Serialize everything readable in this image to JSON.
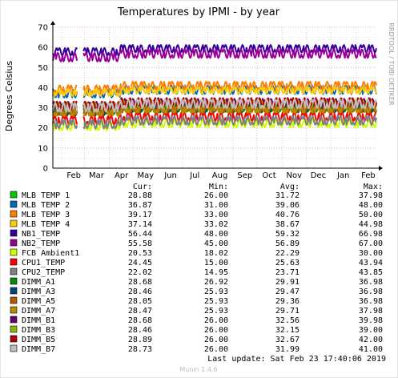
{
  "chart_data": {
    "type": "line",
    "title": "Temperatures by IPMI - by year",
    "ylabel": "Degrees Celsius",
    "ylim": [
      0,
      70
    ],
    "yticks": [
      0,
      10,
      20,
      30,
      40,
      50,
      60,
      70
    ],
    "x_tick_labels": [
      "Feb",
      "Mar",
      "Apr",
      "May",
      "Jun",
      "Jul",
      "Aug",
      "Sep",
      "Oct",
      "Nov",
      "Dec",
      "Jan",
      "Feb"
    ],
    "x_range": [
      "2018-01-21",
      "2019-02-26"
    ],
    "grid": true,
    "side_label": "RRDTOOL / TOBI OETIKER",
    "columns": [
      "Cur:",
      "Min:",
      "Avg:",
      "Max:"
    ],
    "series": [
      {
        "name": "MLB TEMP 1",
        "color": "#00cc00",
        "cur": "28.88",
        "min": "26.00",
        "avg": "31.72",
        "max": "37.98",
        "base": 31.7
      },
      {
        "name": "MLB TEMP 2",
        "color": "#0066b3",
        "cur": "36.87",
        "min": "31.00",
        "avg": "39.06",
        "max": "48.00",
        "base": 39
      },
      {
        "name": "MLB TEMP 3",
        "color": "#ff8000",
        "cur": "39.17",
        "min": "33.00",
        "avg": "40.76",
        "max": "50.00",
        "base": 40.8
      },
      {
        "name": "MLB TEMP 4",
        "color": "#ffcc00",
        "cur": "37.14",
        "min": "33.02",
        "avg": "38.67",
        "max": "44.98",
        "base": 38.7
      },
      {
        "name": "NB1_TEMP",
        "color": "#330099",
        "cur": "56.44",
        "min": "48.00",
        "avg": "59.32",
        "max": "66.98",
        "base": 59.3
      },
      {
        "name": "NB2_TEMP",
        "color": "#990099",
        "cur": "55.58",
        "min": "45.00",
        "avg": "56.89",
        "max": "67.00",
        "base": 56.9
      },
      {
        "name": "FCB Ambient1",
        "color": "#ccff00",
        "cur": "20.53",
        "min": "18.02",
        "avg": "22.29",
        "max": "30.00",
        "base": 22.3
      },
      {
        "name": "CPU1_TEMP",
        "color": "#ff0000",
        "cur": "24.45",
        "min": "15.00",
        "avg": "25.63",
        "max": "43.94",
        "base": 25.6
      },
      {
        "name": "CPU2_TEMP",
        "color": "#808080",
        "cur": "22.02",
        "min": "14.95",
        "avg": "23.71",
        "max": "43.85",
        "base": 23.7
      },
      {
        "name": "DIMM_A1",
        "color": "#008f00",
        "cur": "28.68",
        "min": "26.92",
        "avg": "29.91",
        "max": "36.98",
        "base": 29.9
      },
      {
        "name": "DIMM_A3",
        "color": "#00487d",
        "cur": "28.46",
        "min": "25.93",
        "avg": "29.47",
        "max": "36.98",
        "base": 29.5
      },
      {
        "name": "DIMM_A5",
        "color": "#b35a00",
        "cur": "28.05",
        "min": "25.93",
        "avg": "29.36",
        "max": "36.98",
        "base": 29.4
      },
      {
        "name": "DIMM_A7",
        "color": "#b38f00",
        "cur": "28.47",
        "min": "25.93",
        "avg": "29.71",
        "max": "37.98",
        "base": 29.7
      },
      {
        "name": "DIMM_B1",
        "color": "#6b006b",
        "cur": "28.68",
        "min": "26.00",
        "avg": "32.56",
        "max": "39.98",
        "base": 32.6
      },
      {
        "name": "DIMM_B3",
        "color": "#8fb300",
        "cur": "28.46",
        "min": "26.00",
        "avg": "32.15",
        "max": "39.00",
        "base": 32.2
      },
      {
        "name": "DIMM_B5",
        "color": "#b30000",
        "cur": "28.89",
        "min": "26.00",
        "avg": "32.67",
        "max": "42.00",
        "base": 32.7
      },
      {
        "name": "DIMM_B7",
        "color": "#bebebe",
        "cur": "28.73",
        "min": "26.00",
        "avg": "31.99",
        "max": "41.00",
        "base": 32.0
      }
    ],
    "last_update": "Last update:  Sat Feb 23 17:40:06 2019",
    "version": "Munin 1.4.6"
  }
}
